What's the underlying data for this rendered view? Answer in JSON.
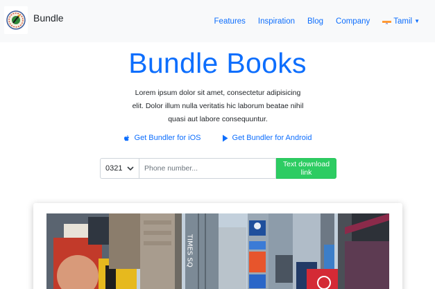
{
  "navbar": {
    "brand_name": "Bundle",
    "links": [
      "Features",
      "Inspiration",
      "Blog",
      "Company"
    ],
    "language": "Tamil"
  },
  "hero": {
    "title": "Bundle Books",
    "lead": "Lorem ipsum dolor sit amet, consectetur adipisicing elit. Dolor illum nulla veritatis hic laborum beatae nihil quasi aut labore consequuntur.",
    "ios_link": "Get Bundler for iOS",
    "android_link": "Get Bundler for Android"
  },
  "form": {
    "country_code": "0321",
    "phone_placeholder": "Phone number...",
    "submit_label": "Text download link"
  },
  "colors": {
    "primary": "#0d6efd",
    "success": "#2dcc62",
    "navbar_bg": "#f8f9fa"
  },
  "icons": [
    "brand-logo",
    "india-flag-icon",
    "caret-down-icon",
    "apple-icon",
    "play-icon",
    "chevron-down-icon"
  ],
  "image": {
    "sign_text": "TIMES SQ"
  }
}
